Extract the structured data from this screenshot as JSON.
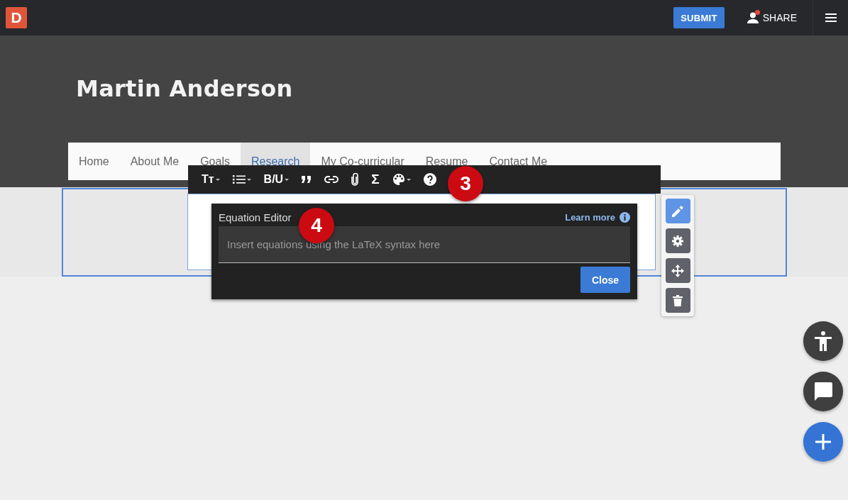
{
  "topbar": {
    "logo": "D",
    "submit": "SUBMIT",
    "share": "SHARE",
    "share_notification": true
  },
  "header": {
    "title": "Martin Anderson"
  },
  "nav": [
    {
      "label": "Home",
      "selected": false
    },
    {
      "label": "About Me",
      "selected": false
    },
    {
      "label": "Goals",
      "selected": false
    },
    {
      "label": "Research",
      "selected": true
    },
    {
      "label": "My Co-curricular",
      "selected": false
    },
    {
      "label": "Resume",
      "selected": false
    },
    {
      "label": "Contact Me",
      "selected": false
    }
  ],
  "toolbar": [
    {
      "kind": "text-size",
      "label": "Tт",
      "caret": true
    },
    {
      "kind": "list",
      "caret": true
    },
    {
      "kind": "format",
      "label": "B/U",
      "caret": true
    },
    {
      "kind": "quote",
      "caret": false
    },
    {
      "kind": "link",
      "caret": false
    },
    {
      "kind": "attach",
      "caret": false
    },
    {
      "kind": "sigma",
      "label": "Σ",
      "caret": false
    },
    {
      "kind": "palette",
      "caret": true
    },
    {
      "kind": "help",
      "caret": false
    }
  ],
  "equation_editor": {
    "title": "Equation Editor",
    "learn_more": "Learn more",
    "placeholder": "Insert equations using the LaTeX syntax here",
    "close": "Close"
  },
  "side_tools": [
    {
      "kind": "edit",
      "selected": true
    },
    {
      "kind": "settings",
      "selected": false
    },
    {
      "kind": "move",
      "selected": false
    },
    {
      "kind": "delete",
      "selected": false
    }
  ],
  "callouts": [
    {
      "label": "3"
    },
    {
      "label": "4"
    }
  ],
  "fabs": [
    {
      "kind": "accessibility"
    },
    {
      "kind": "chat"
    },
    {
      "kind": "add"
    }
  ]
}
